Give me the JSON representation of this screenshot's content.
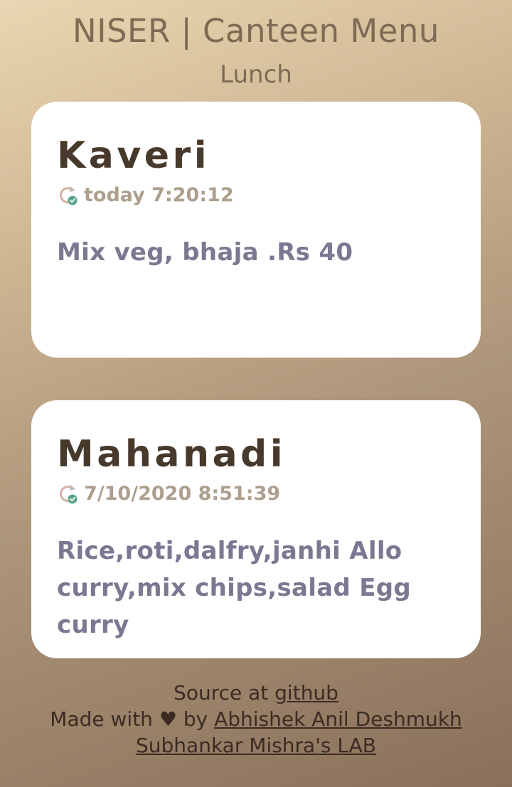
{
  "header": {
    "title": "NISER | Canteen Menu",
    "meal": "Lunch"
  },
  "cards": [
    {
      "name": "Kaveri",
      "updated": "today 7:20:12",
      "menu": "Mix veg, bhaja .Rs 40",
      "icon": "refresh-check-icon"
    },
    {
      "name": "Mahanadi",
      "updated": "7/10/2020 8:51:39",
      "menu": "Rice,roti,dalfry,janhi Allo curry,mix chips,salad Egg curry",
      "icon": "refresh-check-icon"
    }
  ],
  "footer": {
    "source_prefix": "Source at ",
    "source_link": "github",
    "made_prefix": "Made with ",
    "heart": "♥",
    "made_by": " by ",
    "author_link": "Abhishek Anil Deshmukh",
    "lab_link": "Subhankar Mishra's LAB"
  },
  "colors": {
    "title": "#7f6a54",
    "card_name": "#47392b",
    "timestamp": "#ad9f8d",
    "menu_text": "#7c7892",
    "footer_text": "#3b2b22",
    "icon_check": "#5aa58a"
  }
}
